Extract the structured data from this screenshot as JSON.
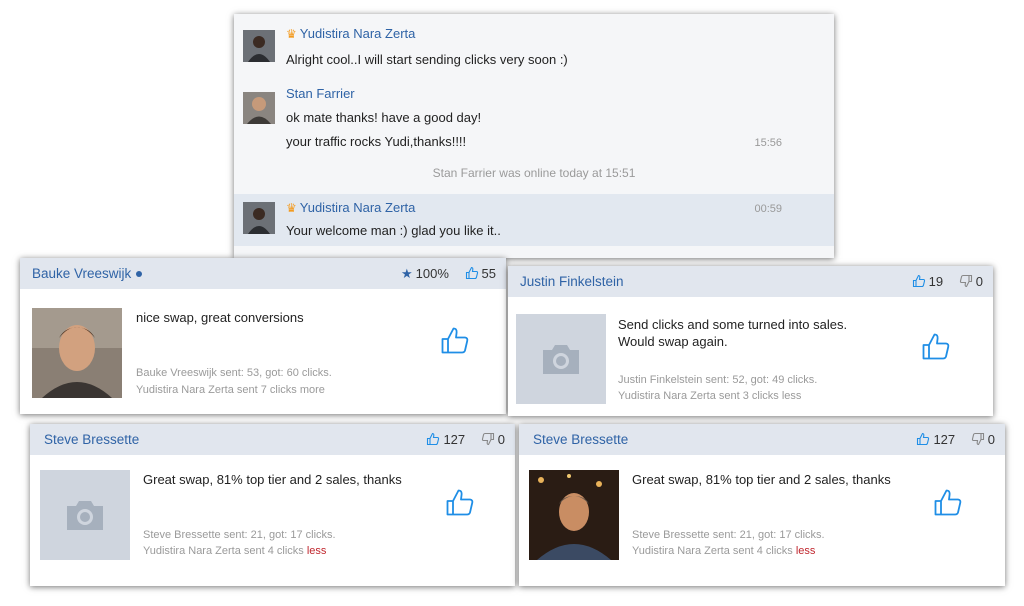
{
  "chat": {
    "messages": [
      {
        "author": "Yudistira Nara Zerta",
        "crown": true,
        "lines": [
          "Alright cool..I will start sending clicks very soon :)"
        ],
        "time": ""
      },
      {
        "author": "Stan Farrier",
        "crown": false,
        "lines": [
          "ok mate thanks! have a good day!",
          "your traffic rocks Yudi,thanks!!!!"
        ],
        "time": "15:56"
      }
    ],
    "status": "Stan Farrier was online today at 15:51",
    "last": {
      "author": "Yudistira Nara Zerta",
      "crown": true,
      "line": "Your welcome man :) glad you like it..",
      "time": "00:59"
    }
  },
  "reviews": [
    {
      "name": "Bauke Vreeswijk",
      "online": true,
      "rating": "100%",
      "likes": "55",
      "dislikes": "",
      "text": "nice swap, great conversions",
      "sent_line": "Bauke Vreeswijk sent: 53, got: 60 clicks.",
      "diff_prefix": "Yudistira Nara Zerta sent 7 clicks ",
      "diff_word": "more"
    },
    {
      "name": "Justin Finkelstein",
      "online": false,
      "rating": "",
      "likes": "19",
      "dislikes": "0",
      "text": "Send clicks and some turned into sales. Would swap again.",
      "sent_line": "Justin Finkelstein sent: 52, got: 49 clicks.",
      "diff_prefix": "Yudistira Nara Zerta sent 3 clicks ",
      "diff_word": "less"
    },
    {
      "name": "Steve Bressette",
      "online": false,
      "rating": "",
      "likes": "127",
      "dislikes": "0",
      "text": "Great swap, 81% top tier and 2 sales, thanks",
      "sent_line": "Steve Bressette sent: 21, got: 17 clicks.",
      "diff_prefix": "Yudistira Nara Zerta sent 4 clicks ",
      "diff_word": "less"
    },
    {
      "name": "Steve Bressette",
      "online": false,
      "rating": "",
      "likes": "127",
      "dislikes": "0",
      "text": "Great swap, 81% top tier and 2 sales, thanks",
      "sent_line": "Steve Bressette sent: 21, got: 17 clicks.",
      "diff_prefix": "Yudistira Nara Zerta sent 4 clicks ",
      "diff_word": "less"
    }
  ],
  "icons": {
    "crown": "crown-icon",
    "like": "thumbs-up-icon",
    "dislike": "thumbs-down-icon",
    "star": "star-icon",
    "camera": "camera-icon",
    "avatar": "avatar"
  },
  "colors": {
    "link": "#2f63a6",
    "header": "#e1e6ee",
    "less": "#c0262d",
    "accent": "#1f8ee6"
  }
}
